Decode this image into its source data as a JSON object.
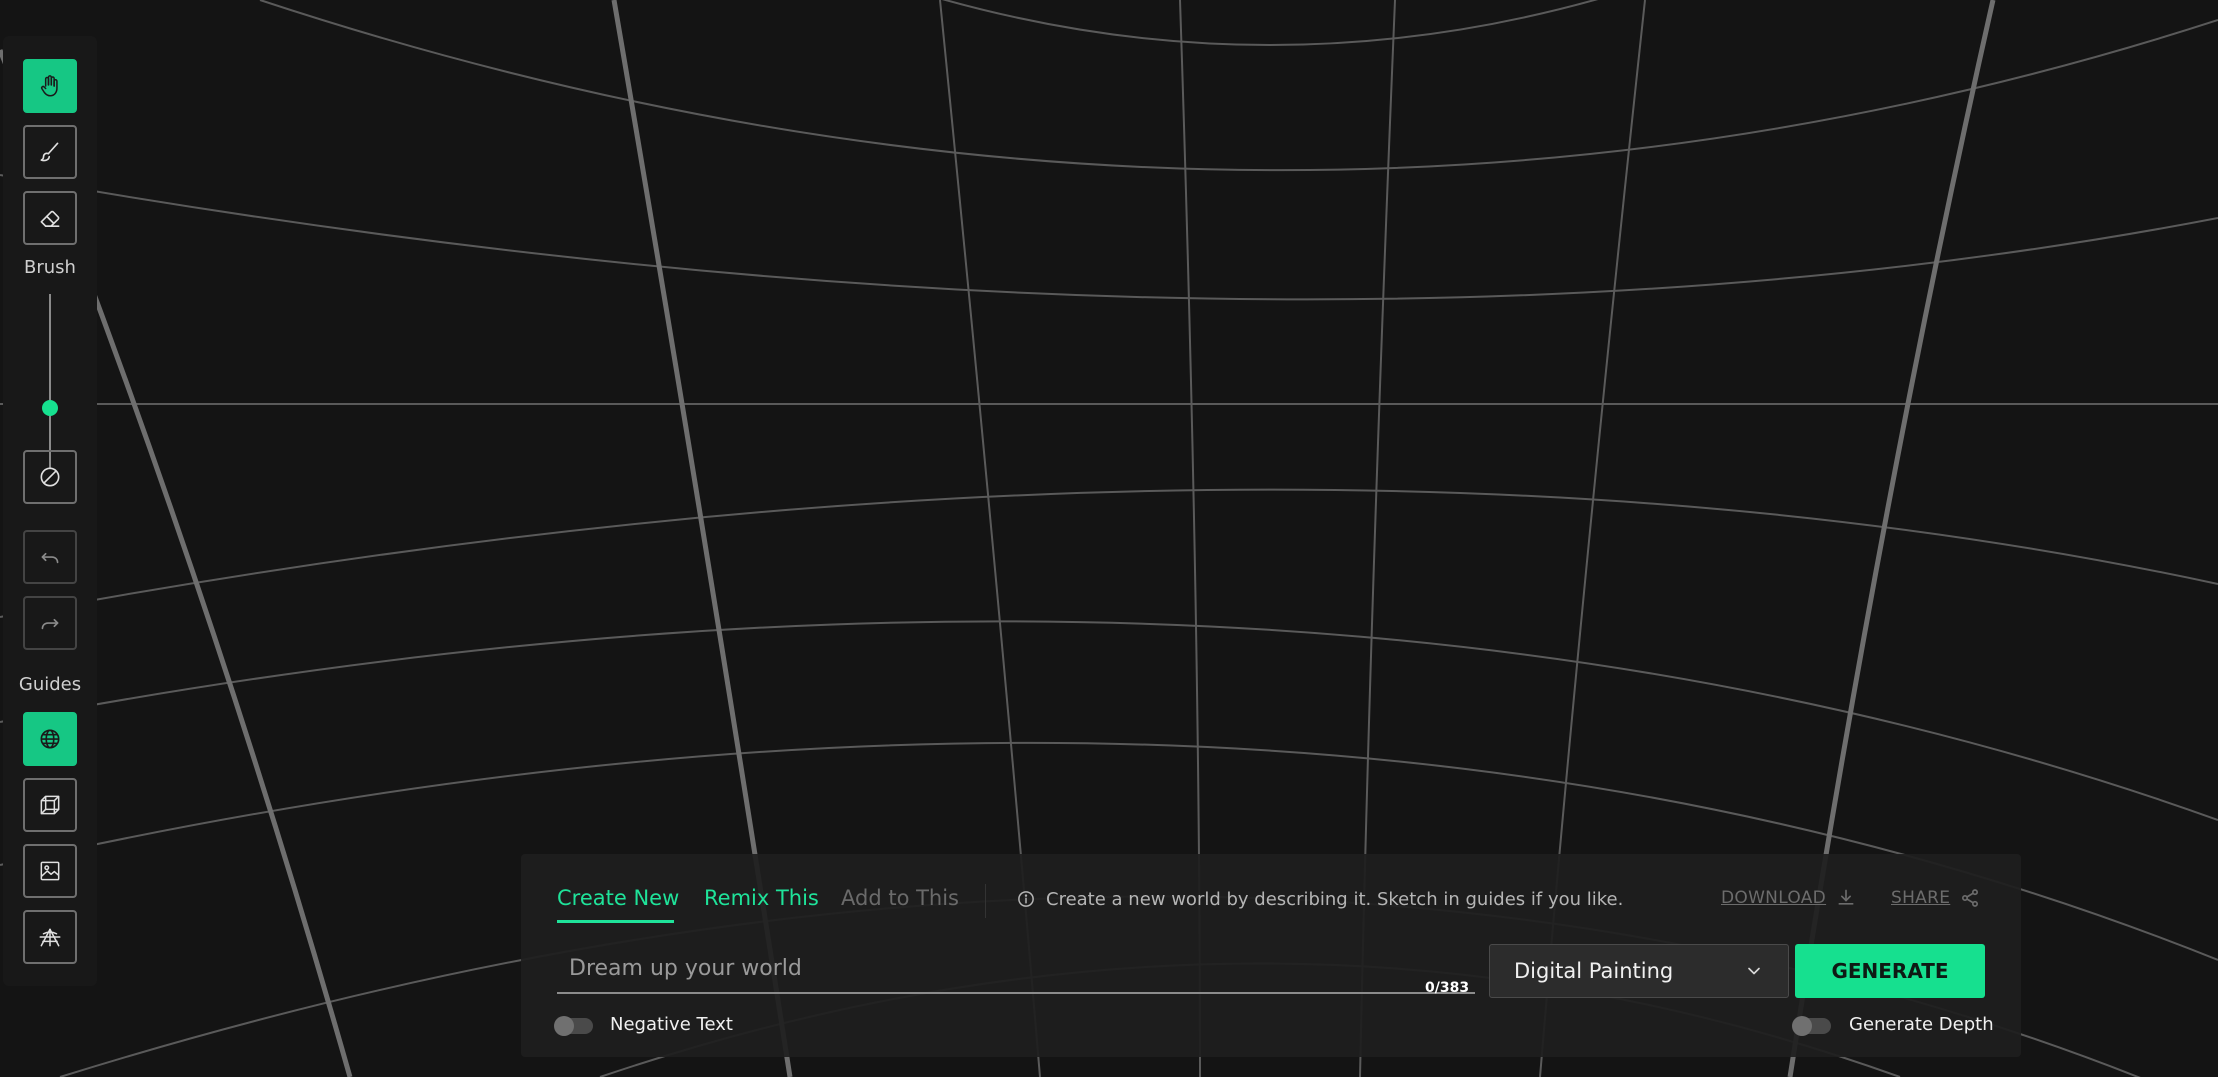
{
  "toolbar": {
    "brush_label": "Brush",
    "guides_label": "Guides",
    "brush_size_fraction": 0.52,
    "tools": [
      {
        "name": "pan",
        "icon": "hand-icon",
        "active": true
      },
      {
        "name": "brush",
        "icon": "brush-icon",
        "active": false
      },
      {
        "name": "eraser",
        "icon": "eraser-icon",
        "active": false
      }
    ],
    "actions": [
      {
        "name": "clear",
        "icon": "clear-circle-icon"
      },
      {
        "name": "undo",
        "icon": "undo-icon"
      },
      {
        "name": "redo",
        "icon": "redo-icon"
      }
    ],
    "guides": [
      {
        "name": "sphere",
        "icon": "globe-icon",
        "active": true
      },
      {
        "name": "box",
        "icon": "cube-icon",
        "active": false
      },
      {
        "name": "image",
        "icon": "image-icon",
        "active": false
      },
      {
        "name": "perspective",
        "icon": "perspective-grid-icon",
        "active": false
      }
    ]
  },
  "panel": {
    "tabs": [
      {
        "label": "Create New",
        "state": "active"
      },
      {
        "label": "Remix This",
        "state": "enabled"
      },
      {
        "label": "Add to This",
        "state": "disabled"
      }
    ],
    "info_text": "Create a new world by describing it. Sketch in guides if you like.",
    "download_label": "DOWNLOAD",
    "share_label": "SHARE",
    "prompt": {
      "value": "",
      "placeholder": "Dream up your world",
      "char_count": "0/383"
    },
    "style_select": {
      "selected": "Digital Painting"
    },
    "generate_label": "GENERATE",
    "negative_text_label": "Negative Text",
    "negative_text_enabled": false,
    "generate_depth_label": "Generate Depth",
    "generate_depth_enabled": false
  },
  "colors": {
    "accent": "#16e08f",
    "background": "#141414",
    "panel": "#1e1e1e"
  }
}
